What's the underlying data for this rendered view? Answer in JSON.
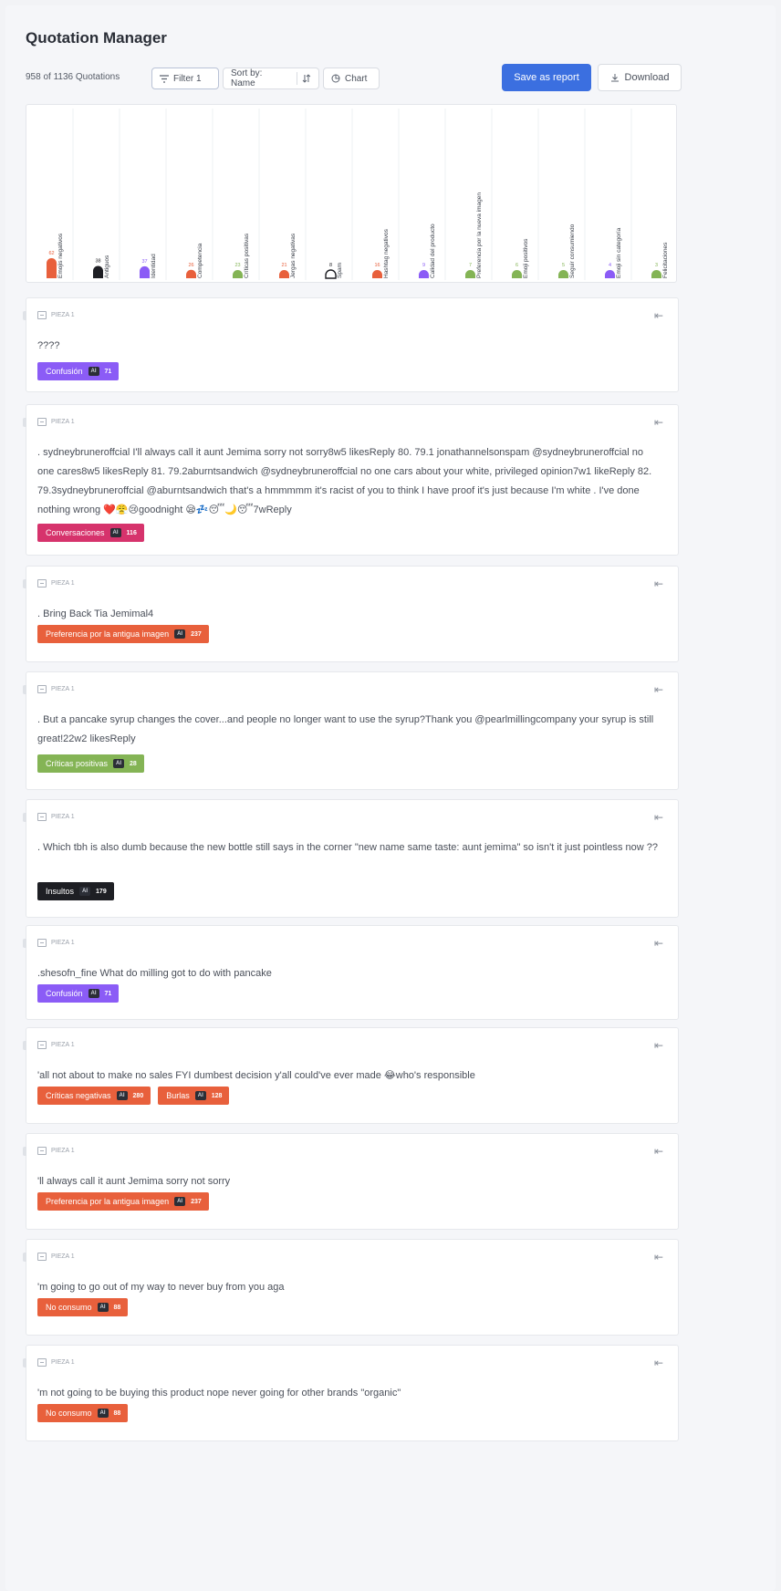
{
  "app": {
    "title": "Quotation Manager"
  },
  "toolbar": {
    "count_text": "958 of 1136 Quotations",
    "filter_label": "Filter 1",
    "sort_label": "Sort by: Name",
    "chart_label": "Chart",
    "save_label": "Save as report",
    "download_label": "Download"
  },
  "chart_data": {
    "type": "bar",
    "categories": [
      "Emojis negativos",
      "Antiguos",
      "Identidad",
      "Competencia",
      "Críticas positivas",
      "Jergas negativas",
      "Spam",
      "Hashtag negativos",
      "Calidad del producto",
      "Preferencia por la nueva imagen",
      "Emoji positivos",
      "Seguir consumiendo",
      "Emoji sin categoría",
      "Felicitaciones"
    ],
    "values": [
      62,
      38,
      37,
      26,
      23,
      21,
      8,
      16,
      9,
      7,
      6,
      5,
      4,
      3
    ],
    "colors": [
      "#e8603c",
      "#1e1f24",
      "#8b5cf6",
      "#e8603c",
      "#84b455",
      "#e8603c",
      "#1e1f24",
      "#e8603c",
      "#8b5cf6",
      "#84b455",
      "#84b455",
      "#84b455",
      "#8b5cf6",
      "#84b455"
    ],
    "outlined": [
      false,
      false,
      false,
      false,
      false,
      false,
      true,
      false,
      false,
      false,
      false,
      false,
      false,
      false
    ],
    "grid": true,
    "legend": "none"
  },
  "quotes": [
    {
      "source": "PIEZA 1",
      "text": "????",
      "tags": [
        {
          "label": "Confusión",
          "ai": "AI",
          "count": "71",
          "color": "#8b5cf6"
        }
      ]
    },
    {
      "source": "PIEZA 1",
      "text": ". sydneybruneroffcial I'll always call it aunt Jemima sorry not sorry8w5 likesReply 80. 79.1 jonathannelsonspam @sydneybruneroffcial no one cares8w5 likesReply 81. 79.2aburntsandwich @sydneybruneroffcial no one cars about your white, privileged opinion7w1 likeReply 82. 79.3sydneybruneroffcial @aburntsandwich that's a hmmmmm it's racist of you to think I have proof it's just because I'm white . I've done nothing wrong ❤️😤😢goodnight 😪💤😴🌙😴7wReply",
      "tags": [
        {
          "label": "Conversaciones",
          "ai": "AI",
          "count": "116",
          "color": "#d6336c"
        }
      ]
    },
    {
      "source": "PIEZA 1",
      "text": ". Bring Back Tia Jemimal4",
      "tags": [
        {
          "label": "Preferencia por la antigua imagen",
          "ai": "AI",
          "count": "237",
          "color": "#e8603c"
        }
      ]
    },
    {
      "source": "PIEZA 1",
      "text": ". But a pancake syrup changes the cover...and people no longer want to use the syrup?Thank you @pearlmillingcompany your syrup is still great!22w2 likesReply",
      "tags": [
        {
          "label": "Críticas positivas",
          "ai": "AI",
          "count": "28",
          "color": "#84b455"
        }
      ]
    },
    {
      "source": "PIEZA 1",
      "text": ". Which tbh is also dumb because the new bottle still says in the corner \"new name same taste: aunt jemima\" so isn't it just pointless now ??",
      "tags": [
        {
          "label": "Insultos",
          "ai": "AI",
          "count": "179",
          "color": "#1e1f24"
        }
      ]
    },
    {
      "source": "PIEZA 1",
      "text": ".shesofn_fine What do milling got to do with pancake",
      "tags": [
        {
          "label": "Confusión",
          "ai": "AI",
          "count": "71",
          "color": "#8b5cf6"
        }
      ]
    },
    {
      "source": "PIEZA 1",
      "text": "'all not about to make no sales FYI dumbest decision y'all could've ever made 😂who's responsible",
      "tags": [
        {
          "label": "Críticas negativas",
          "ai": "AI",
          "count": "280",
          "color": "#e8603c"
        },
        {
          "label": "Burlas",
          "ai": "AI",
          "count": "128",
          "color": "#e8603c"
        }
      ]
    },
    {
      "source": "PIEZA 1",
      "text": "'ll always call it aunt Jemima sorry not sorry",
      "tags": [
        {
          "label": "Preferencia por la antigua imagen",
          "ai": "AI",
          "count": "237",
          "color": "#e8603c"
        }
      ]
    },
    {
      "source": "PIEZA 1",
      "text": "'m going to go out of my way to never buy from you aga",
      "tags": [
        {
          "label": "No consumo",
          "ai": "AI",
          "count": "88",
          "color": "#e8603c"
        }
      ]
    },
    {
      "source": "PIEZA 1",
      "text": "'m not going to be buying this product nope never going for other brands \"organic\"",
      "tags": [
        {
          "label": "No consumo",
          "ai": "AI",
          "count": "88",
          "color": "#e8603c"
        }
      ]
    }
  ],
  "icons": {
    "filter": "filter-icon",
    "sort": "sort-arrows-icon",
    "chart": "chart-icon",
    "download": "download-icon",
    "collapse": "collapse-icon",
    "document": "document-icon"
  }
}
